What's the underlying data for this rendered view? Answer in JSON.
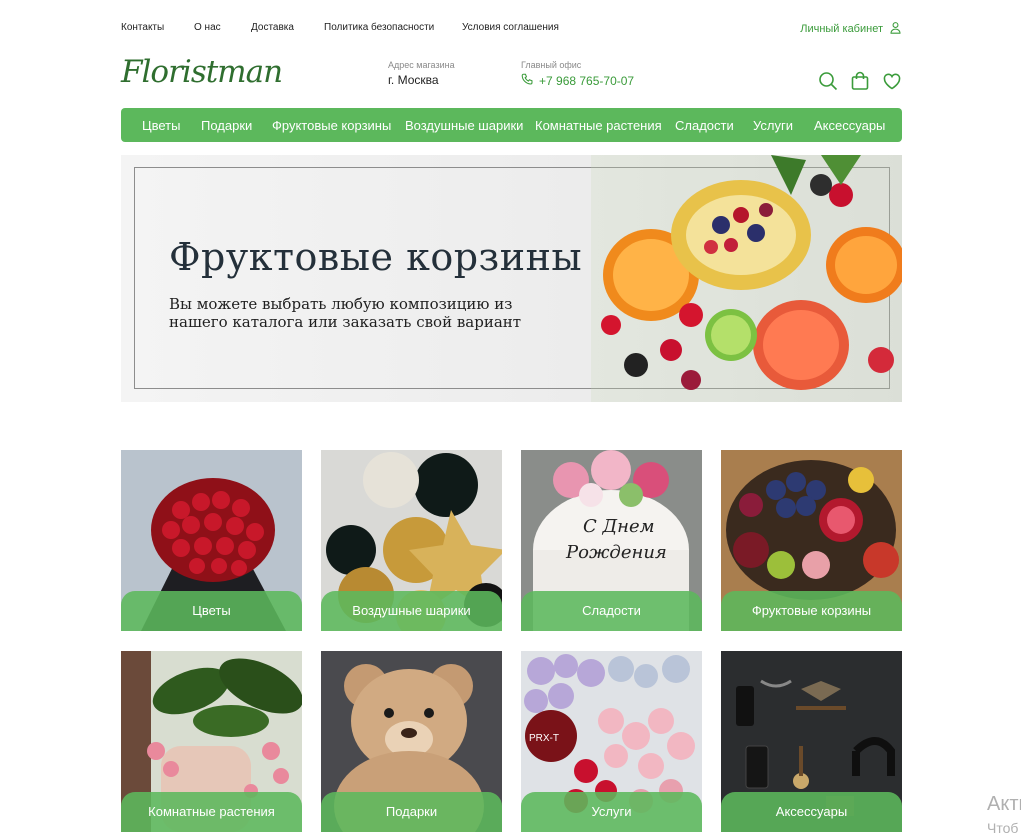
{
  "topbar": {
    "links": [
      "Контакты",
      "О нас",
      "Доставка",
      "Политика безопасности",
      "Условия соглашения"
    ],
    "account_label": "Личный кабинет"
  },
  "header": {
    "logo": "Floristman",
    "address_label": "Адрес магазина",
    "address_value": "г. Москва",
    "office_label": "Главный офис",
    "office_phone": "+7 968 765-70-07"
  },
  "nav": {
    "items": [
      "Цветы",
      "Подарки",
      "Фруктовые корзины",
      "Воздушные шарики",
      "Комнатные растения",
      "Сладости",
      "Услуги",
      "Аксессуары"
    ]
  },
  "banner": {
    "title": "Фруктовые корзины",
    "text": "Вы можете выбрать любую композицию из нашего каталога или заказать свой вариант"
  },
  "categories": [
    {
      "label": "Цветы"
    },
    {
      "label": "Воздушные шарики"
    },
    {
      "label": "Сладости"
    },
    {
      "label": "Фруктовые корзины"
    },
    {
      "label": "Комнатные растения"
    },
    {
      "label": "Подарки"
    },
    {
      "label": "Услуги"
    },
    {
      "label": "Аксессуары"
    }
  ],
  "watermark": {
    "line1": "Акти",
    "line2": "Чтоб"
  },
  "colors": {
    "accent": "#5cb85c",
    "accent_text": "#3a9b3a"
  },
  "icons": [
    "user-icon",
    "phone-icon",
    "search-icon",
    "cart-icon",
    "heart-icon"
  ]
}
